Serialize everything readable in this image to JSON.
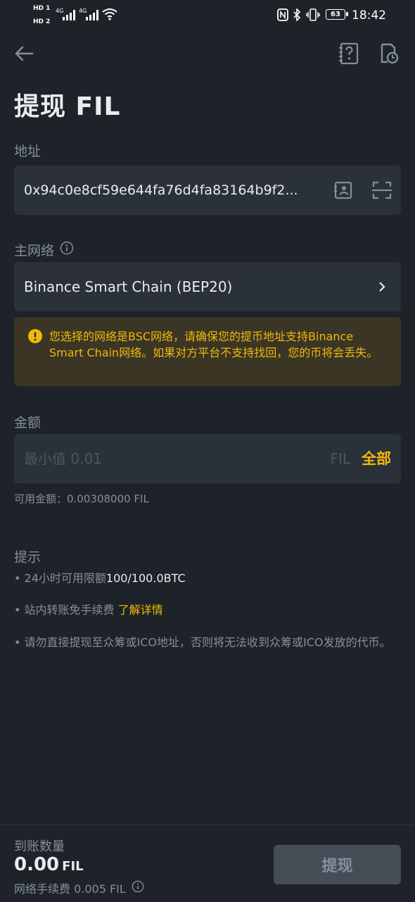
{
  "status_bar": {
    "hd1": "HD 1",
    "hd2": "HD 2",
    "net1": "4G",
    "net2": "4G",
    "battery": "63",
    "time": "18:42"
  },
  "header": {
    "back_icon": "arrow-left-icon",
    "help_icon": "question-book-icon",
    "history_icon": "document-clock-icon",
    "title": "提现 FIL"
  },
  "address": {
    "label": "地址",
    "value": "0x94c0e8cf59e644fa76d4fa83164b9f2..."
  },
  "network": {
    "label": "主网络",
    "value": "Binance Smart Chain (BEP20)"
  },
  "warning": {
    "text": "您选择的网络是BSC网络，请确保您的提币地址支持Binance Smart Chain网络。如果对方平台不支持找回，您的币将会丢失。"
  },
  "amount": {
    "label": "金额",
    "placeholder": "最小值 0.01",
    "unit": "FIL",
    "all_label": "全部",
    "available": "可用金额：0.00308000 FIL"
  },
  "tips": {
    "title": "提示",
    "tip1_prefix": "• 24小时可用限额",
    "tip1_value": "100/100.0BTC",
    "tip2_prefix": "• 站内转账免手续费 ",
    "tip2_link": "了解详情",
    "tip3": "• 请勿直接提现至众筹或ICO地址，否则将无法收到众筹或ICO发放的代币。"
  },
  "footer": {
    "receive_label": "到账数量",
    "receive_amount": "0.00",
    "receive_unit": "FIL",
    "fee": "网络手续费 0.005 FIL",
    "submit_label": "提现"
  },
  "colors": {
    "background": "#1e2329",
    "field": "#2b3139",
    "accent": "#f0b90b",
    "muted": "#848e9c"
  }
}
